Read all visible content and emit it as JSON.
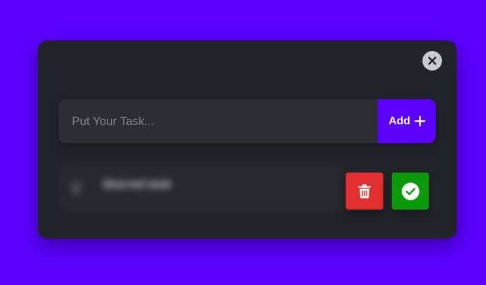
{
  "task_form": {
    "placeholder": "Put Your Task...",
    "value": "",
    "add_label": "Add"
  },
  "tasks": [
    {
      "text": "blurred task"
    }
  ],
  "icons": {
    "close": "close-icon",
    "add": "plus-icon",
    "delete": "trash-icon",
    "complete": "check-circle-icon"
  },
  "colors": {
    "background": "#5c00ff",
    "card": "#212429",
    "accent": "#5c00ff",
    "delete": "#e1302f",
    "complete": "#0b9a0a"
  }
}
